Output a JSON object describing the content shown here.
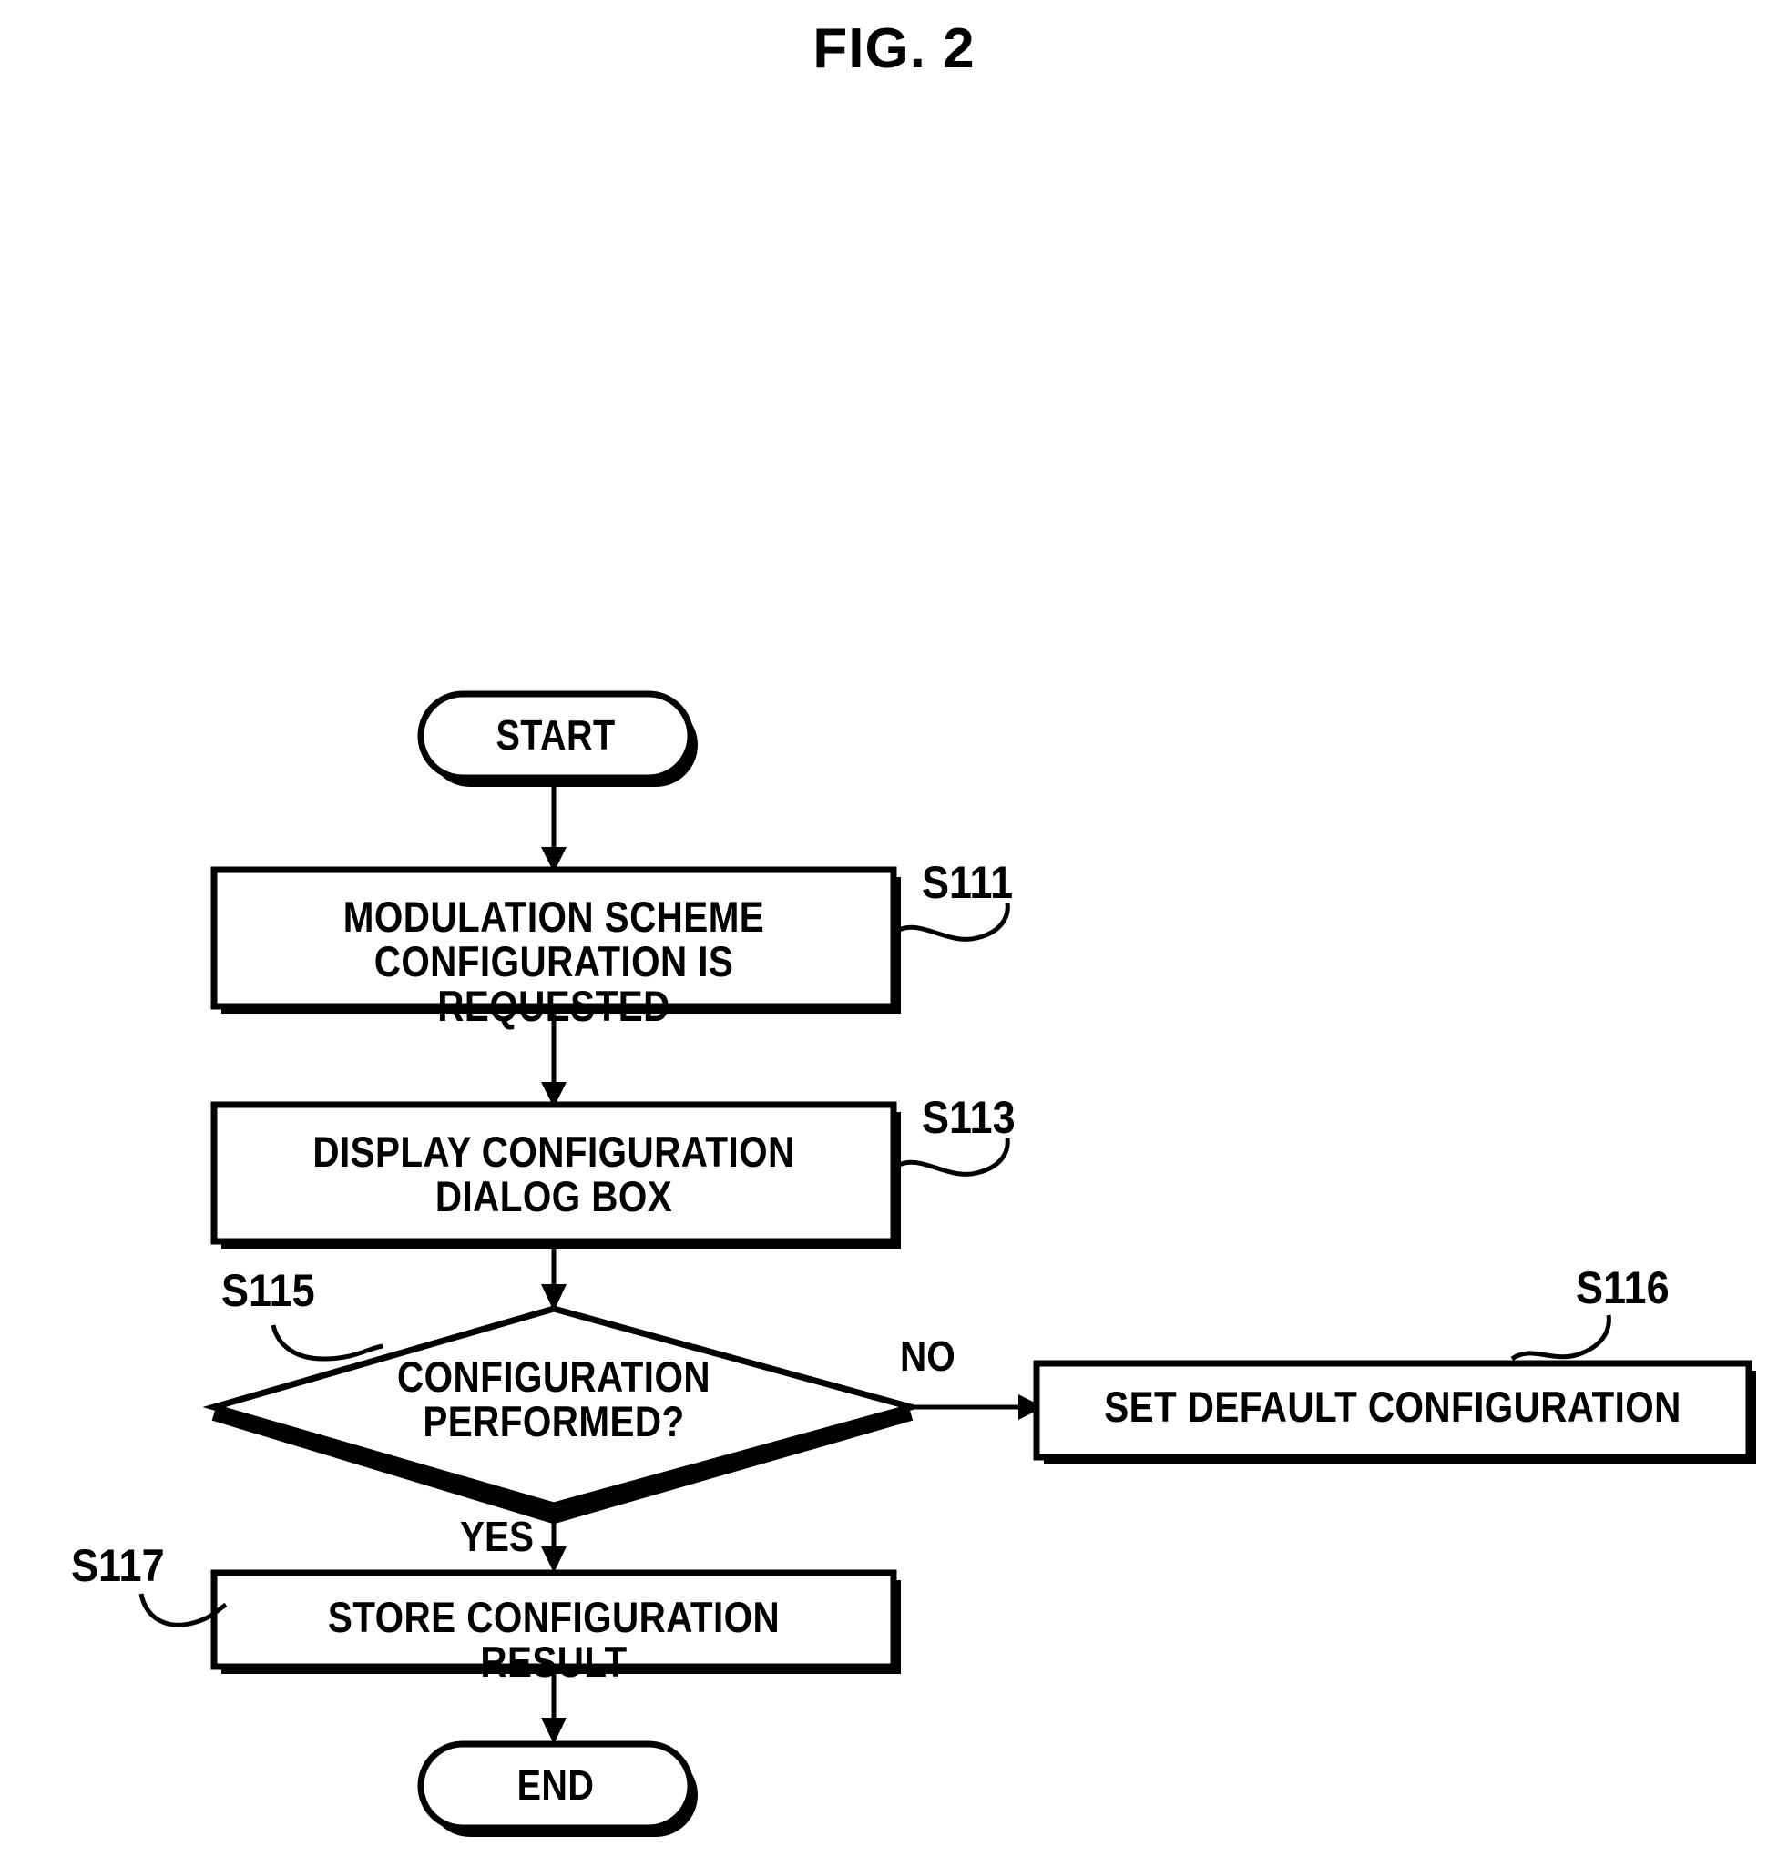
{
  "figure": {
    "title": "FIG. 2"
  },
  "flowchart": {
    "nodes": [
      {
        "id": "start",
        "type": "terminator",
        "label": "START"
      },
      {
        "id": "s111",
        "type": "process",
        "label": "MODULATION SCHEME\nCONFIGURATION IS REQUESTED",
        "ref": "S111"
      },
      {
        "id": "s113",
        "type": "process",
        "label": "DISPLAY CONFIGURATION\nDIALOG BOX",
        "ref": "S113"
      },
      {
        "id": "s115",
        "type": "decision",
        "label": "CONFIGURATION\nPERFORMED?",
        "ref": "S115"
      },
      {
        "id": "s116",
        "type": "process",
        "label": "SET DEFAULT CONFIGURATION",
        "ref": "S116"
      },
      {
        "id": "s117",
        "type": "process",
        "label": "STORE CONFIGURATION RESULT",
        "ref": "S117"
      },
      {
        "id": "end",
        "type": "terminator",
        "label": "END"
      }
    ],
    "branches": {
      "yes": "YES",
      "no": "NO"
    },
    "refs": {
      "s111": "S111",
      "s113": "S113",
      "s115": "S115",
      "s116": "S116",
      "s117": "S117"
    },
    "colors": {
      "stroke": "#000000",
      "fill": "#ffffff",
      "background": "#ffffff"
    }
  }
}
